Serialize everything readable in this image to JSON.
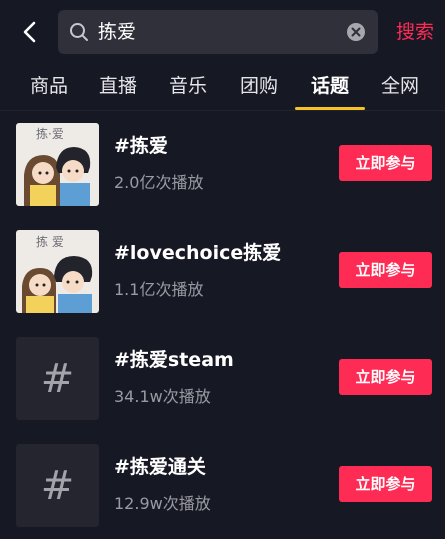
{
  "search": {
    "query": "拣爱",
    "submit_label": "搜索"
  },
  "tabs": [
    {
      "label": "商品"
    },
    {
      "label": "直播"
    },
    {
      "label": "音乐"
    },
    {
      "label": "团购"
    },
    {
      "label": "话题",
      "active": true
    },
    {
      "label": "全网"
    }
  ],
  "results": [
    {
      "title": "#拣爱",
      "views": "2.0亿次播放",
      "thumb_text": "拣·爱",
      "action_label": "立即参与"
    },
    {
      "title": "#lovechoice拣爱",
      "views": "1.1亿次播放",
      "thumb_text": "拣  爱",
      "action_label": "立即参与"
    },
    {
      "title": "#拣爱steam",
      "views": "34.1w次播放",
      "thumb_icon": "hashtag-icon",
      "action_label": "立即参与"
    },
    {
      "title": "#拣爱通关",
      "views": "12.9w次播放",
      "thumb_icon": "hashtag-icon",
      "action_label": "立即参与"
    }
  ],
  "colors": {
    "background": "#161823",
    "accent": "#fe2c55",
    "tab_indicator": "#f5c22a",
    "search_box": "#2f3039"
  }
}
